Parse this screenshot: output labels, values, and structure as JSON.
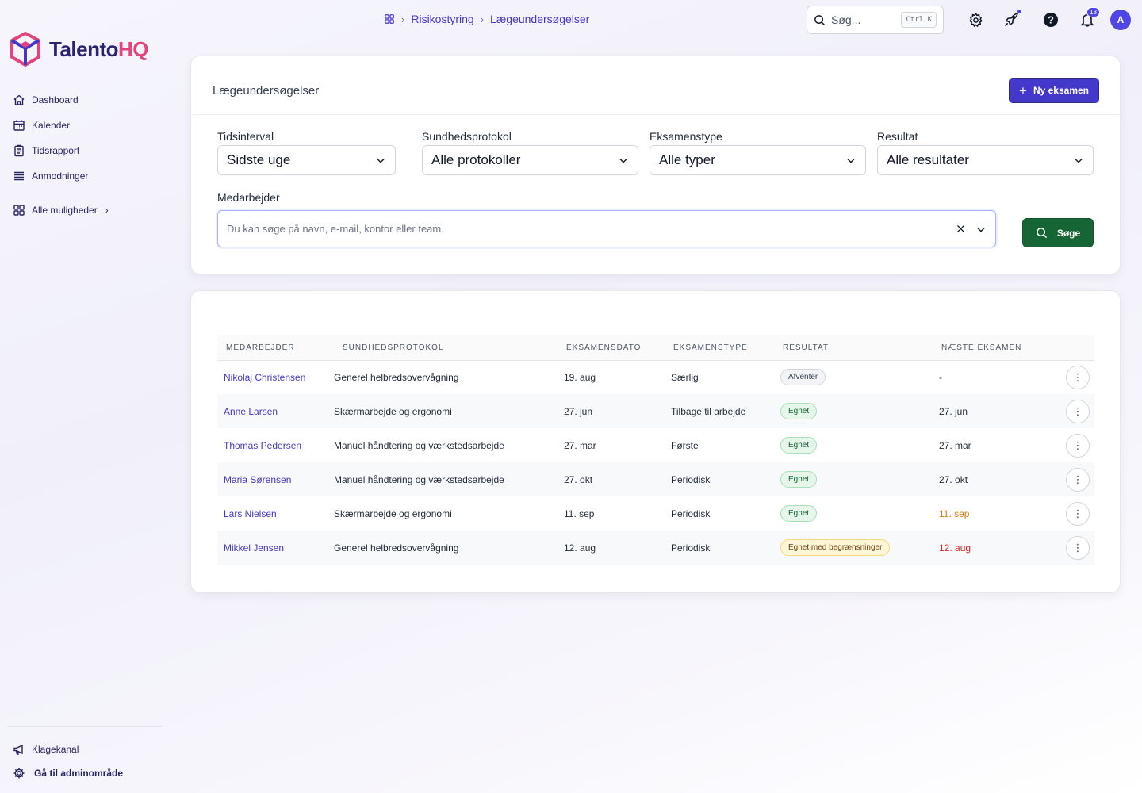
{
  "brand": {
    "name_part1": "Talento",
    "name_part2": "HQ",
    "accent": "#e0457b",
    "primary": "#4338ca"
  },
  "sidebar": {
    "items": [
      {
        "label": "Dashboard",
        "icon": "home-icon"
      },
      {
        "label": "Kalender",
        "icon": "calendar-icon"
      },
      {
        "label": "Tidsrapport",
        "icon": "clipboard-icon"
      },
      {
        "label": "Anmodninger",
        "icon": "list-icon"
      }
    ],
    "all_options": "Alle muligheder",
    "bottom": [
      {
        "label": "Klagekanal",
        "icon": "megaphone-icon"
      },
      {
        "label": "Gå til adminområde",
        "icon": "gear-icon"
      }
    ]
  },
  "breadcrumb": {
    "items": [
      "Risikostyring",
      "Lægeundersøgelser"
    ]
  },
  "topbar": {
    "search_placeholder": "Søg...",
    "search_shortcut": "Ctrl K",
    "notification_count": "18",
    "avatar_initial": "A"
  },
  "page": {
    "title": "Lægeundersøgelser",
    "new_button": "Ny eksamen",
    "filters": [
      {
        "label": "Tidsinterval",
        "value": "Sidste uge"
      },
      {
        "label": "Sundhedsprotokol",
        "value": "Alle protokoller"
      },
      {
        "label": "Eksamenstype",
        "value": "Alle typer"
      },
      {
        "label": "Resultat",
        "value": "Alle resultater"
      }
    ],
    "employee_label": "Medarbejder",
    "employee_placeholder": "Du kan søge på navn, e-mail, kontor eller team.",
    "search_button": "Søge"
  },
  "table": {
    "headers": [
      "MEDARBEJDER",
      "SUNDHEDSPROTOKOL",
      "EKSAMENSDATO",
      "EKSAMENSTYPE",
      "RESULTAT",
      "NÆSTE EKSAMEN"
    ],
    "rows": [
      {
        "employee": "Nikolaj Christensen",
        "protocol": "Generel helbredsovervågning",
        "date": "19. aug",
        "type": "Særlig",
        "result": "Afventer",
        "result_style": "grey",
        "next": "-",
        "next_style": ""
      },
      {
        "employee": "Anne Larsen",
        "protocol": "Skærmarbejde og ergonomi",
        "date": "27. jun",
        "type": "Tilbage til arbejde",
        "result": "Egnet",
        "result_style": "green",
        "next": "27. jun",
        "next_style": ""
      },
      {
        "employee": "Thomas Pedersen",
        "protocol": "Manuel håndtering og værkstedsarbejde",
        "date": "27. mar",
        "type": "Første",
        "result": "Egnet",
        "result_style": "green",
        "next": "27. mar",
        "next_style": ""
      },
      {
        "employee": "Maria Sørensen",
        "protocol": "Manuel håndtering og værkstedsarbejde",
        "date": "27. okt",
        "type": "Periodisk",
        "result": "Egnet",
        "result_style": "green",
        "next": "27. okt",
        "next_style": ""
      },
      {
        "employee": "Lars Nielsen",
        "protocol": "Skærmarbejde og ergonomi",
        "date": "11. sep",
        "type": "Periodisk",
        "result": "Egnet",
        "result_style": "green",
        "next": "11. sep",
        "next_style": "amber"
      },
      {
        "employee": "Mikkel Jensen",
        "protocol": "Generel helbredsovervågning",
        "date": "12. aug",
        "type": "Periodisk",
        "result": "Egnet med begrænsninger",
        "result_style": "yellow",
        "next": "12. aug",
        "next_style": "red"
      }
    ]
  }
}
